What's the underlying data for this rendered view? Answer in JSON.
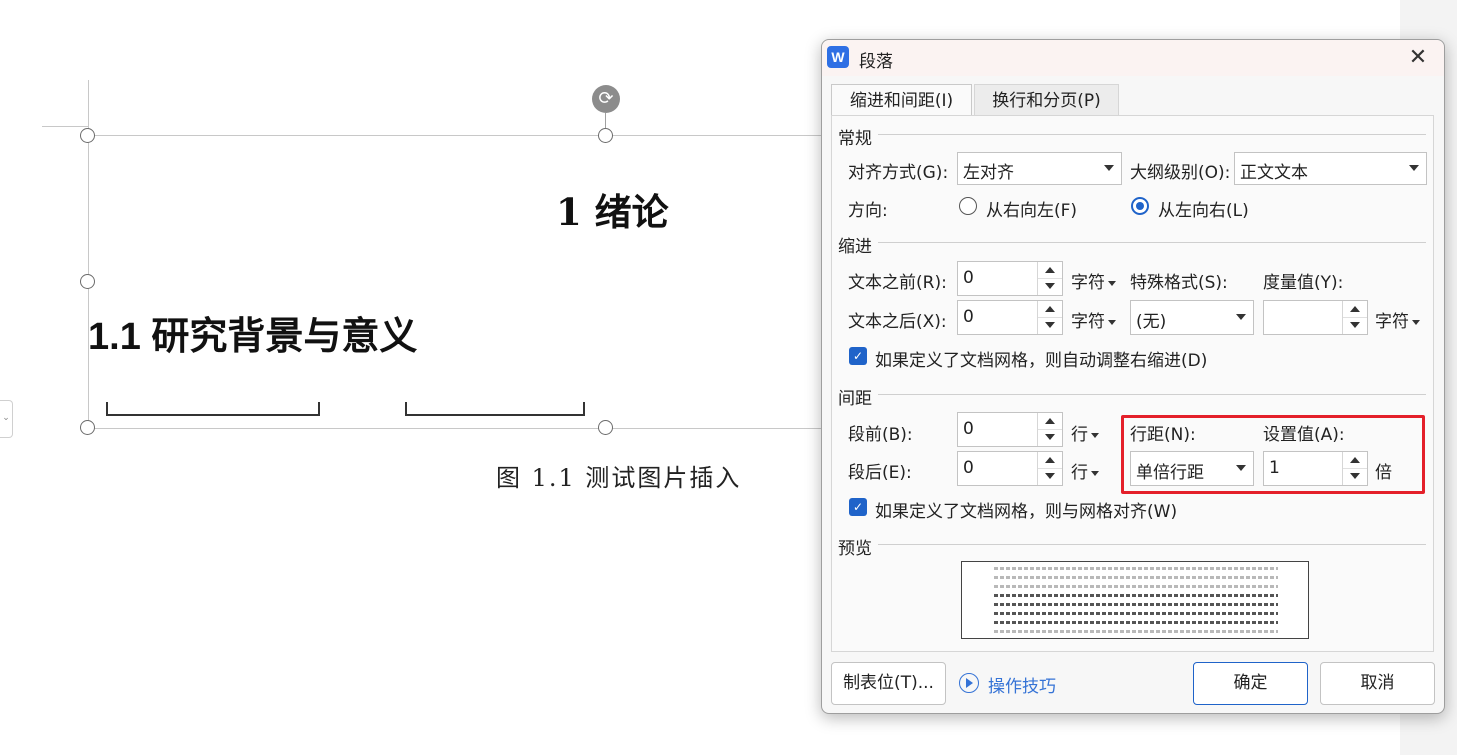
{
  "document": {
    "chapter_heading": "1   绪论",
    "section_heading": "1.1  研究背景与意义",
    "figure_caption": "图 1.1 测试图片插入"
  },
  "dialog": {
    "title": "段落",
    "app_icon_letter": "W",
    "close_glyph": "✕",
    "tabs": [
      {
        "label": "缩进和间距(I)",
        "active": true
      },
      {
        "label": "换行和分页(P)",
        "active": false
      }
    ],
    "general": {
      "title": "常规",
      "alignment_label": "对齐方式(G):",
      "alignment_value": "左对齐",
      "outline_label": "大纲级别(O):",
      "outline_value": "正文文本",
      "direction_label": "方向:",
      "rtl_label": "从右向左(F)",
      "ltr_label": "从左向右(L)",
      "direction_selected": "ltr"
    },
    "indent": {
      "title": "缩进",
      "before_label": "文本之前(R):",
      "before_value": "0",
      "before_unit": "字符",
      "after_label": "文本之后(X):",
      "after_value": "0",
      "after_unit": "字符",
      "special_label": "特殊格式(S):",
      "special_value": "(无)",
      "measure_label": "度量值(Y):",
      "measure_value": "",
      "measure_unit": "字符",
      "grid_checkbox_label": "如果定义了文档网格，则自动调整右缩进(D)",
      "grid_checkbox_checked": true
    },
    "spacing": {
      "title": "间距",
      "before_label": "段前(B):",
      "before_value": "0",
      "before_unit": "行",
      "after_label": "段后(E):",
      "after_value": "0",
      "after_unit": "行",
      "line_spacing_label": "行距(N):",
      "line_spacing_value": "单倍行距",
      "set_value_label": "设置值(A):",
      "set_value": "1",
      "set_value_unit": "倍",
      "grid_checkbox_label": "如果定义了文档网格，则与网格对齐(W)",
      "grid_checkbox_checked": true
    },
    "preview": {
      "title": "预览"
    },
    "footer": {
      "tabs_button": "制表位(T)...",
      "tips_link": "操作技巧",
      "ok_button": "确定",
      "cancel_button": "取消"
    }
  },
  "colors": {
    "accent": "#1f63c9",
    "highlight_box": "#e4202a",
    "link": "#3573d6"
  }
}
